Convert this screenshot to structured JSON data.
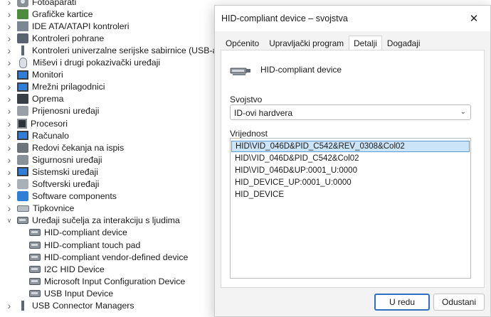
{
  "tree": {
    "categories": [
      {
        "label": "Fotoaparati",
        "icon": "camera-icon",
        "expanded": false
      },
      {
        "label": "Grafičke kartice",
        "icon": "display-adapter-icon",
        "expanded": false
      },
      {
        "label": "IDE ATA/ATAPI kontroleri",
        "icon": "ide-controller-icon",
        "expanded": false
      },
      {
        "label": "Kontroleri pohrane",
        "icon": "storage-controller-icon",
        "expanded": false
      },
      {
        "label": "Kontroleri univerzalne serijske sabirnice (USB-a)",
        "icon": "usb-icon",
        "expanded": false
      },
      {
        "label": "Miševi i drugi pokazivački uređaji",
        "icon": "mouse-icon",
        "expanded": false
      },
      {
        "label": "Monitori",
        "icon": "monitor-icon",
        "expanded": false
      },
      {
        "label": "Mrežni prilagodnici",
        "icon": "network-adapter-icon",
        "expanded": false
      },
      {
        "label": "Oprema",
        "icon": "firmware-icon",
        "expanded": false
      },
      {
        "label": "Prijenosni uređaji",
        "icon": "portable-device-icon",
        "expanded": false
      },
      {
        "label": "Procesori",
        "icon": "processor-icon",
        "expanded": false
      },
      {
        "label": "Računalo",
        "icon": "computer-icon",
        "expanded": false
      },
      {
        "label": "Redovi čekanja na ispis",
        "icon": "print-queue-icon",
        "expanded": false
      },
      {
        "label": "Sigurnosni uređaji",
        "icon": "security-device-icon",
        "expanded": false
      },
      {
        "label": "Sistemski uređaji",
        "icon": "system-device-icon",
        "expanded": false
      },
      {
        "label": "Softverski uređaji",
        "icon": "software-device-icon",
        "expanded": false
      },
      {
        "label": "Software components",
        "icon": "software-component-icon",
        "expanded": false
      },
      {
        "label": "Tipkovnice",
        "icon": "keyboard-icon",
        "expanded": false
      },
      {
        "label": "Uređaji sučelja za interakciju s ljudima",
        "icon": "hid-icon",
        "expanded": true
      }
    ],
    "hid_children": [
      {
        "label": "HID-compliant device"
      },
      {
        "label": "HID-compliant touch pad"
      },
      {
        "label": "HID-compliant vendor-defined device"
      },
      {
        "label": "I2C HID Device"
      },
      {
        "label": "Microsoft Input Configuration Device"
      },
      {
        "label": "USB Input Device"
      }
    ],
    "last_partial": {
      "label": "USB Connector Managers"
    }
  },
  "dialog": {
    "title": "HID-compliant device – svojstva",
    "close_glyph": "✕",
    "tabs": [
      {
        "label": "Općenito",
        "active": false
      },
      {
        "label": "Upravljački program",
        "active": false
      },
      {
        "label": "Detalji",
        "active": true
      },
      {
        "label": "Događaji",
        "active": false
      }
    ],
    "device_name": "HID-compliant device",
    "property_label": "Svojstvo",
    "property_value": "ID-ovi hardvera",
    "value_label": "Vrijednost",
    "values": [
      "HID\\VID_046D&PID_C542&REV_0308&Col02",
      "HID\\VID_046D&PID_C542&Col02",
      "HID\\VID_046D&UP:0001_U:0000",
      "HID_DEVICE_UP:0001_U:0000",
      "HID_DEVICE"
    ],
    "selected_value_index": 0,
    "ok_label": "U redu",
    "cancel_label": "Odustani"
  },
  "colors": {
    "selection_bg": "#cce4f7",
    "selection_border": "#5b9bd5",
    "accent": "#2f6fbf",
    "dialog_bg": "#f3f3f3"
  }
}
